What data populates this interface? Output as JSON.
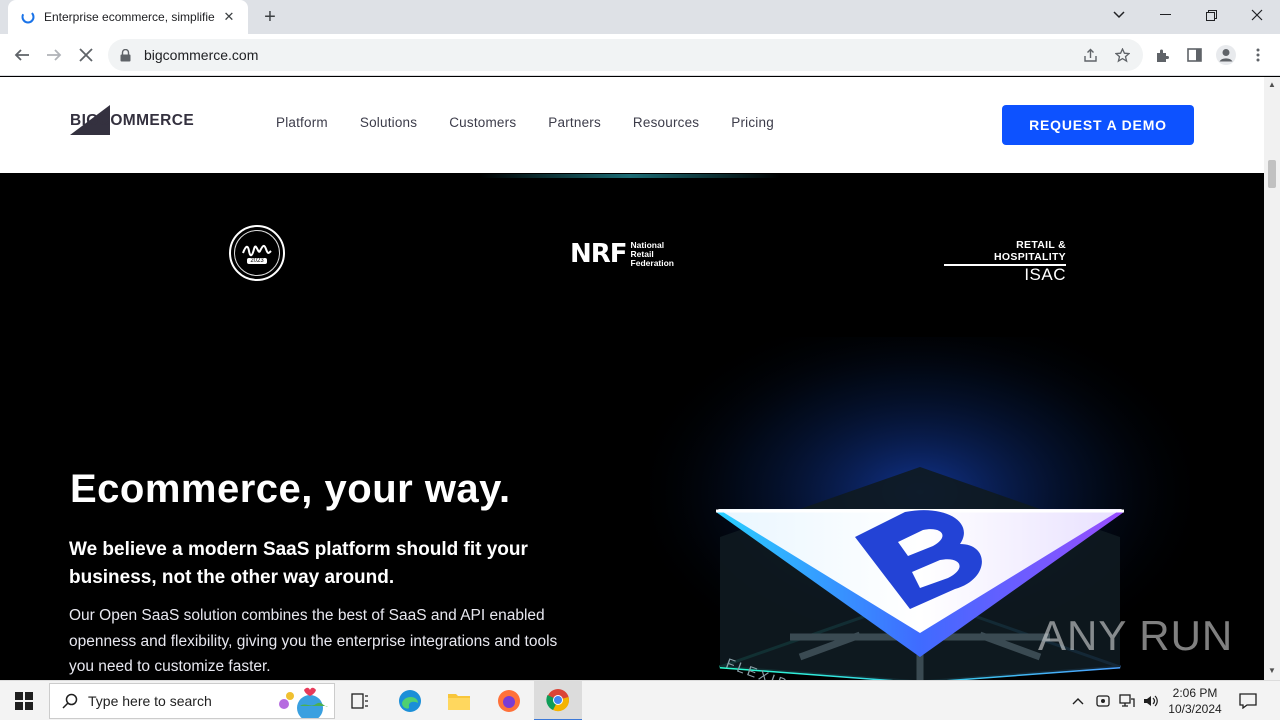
{
  "browser": {
    "tab_title": "Enterprise ecommerce, simplifie",
    "url": "bigcommerce.com"
  },
  "site": {
    "logo_text": "BIGCOMMERCE",
    "nav": [
      "Platform",
      "Solutions",
      "Customers",
      "Partners",
      "Resources",
      "Pricing"
    ],
    "cta": "REQUEST A DEMO"
  },
  "badges": {
    "seal_text": "2023",
    "nrf_big": "NRF",
    "nrf_line1": "National",
    "nrf_line2": "Retail",
    "nrf_line3": "Federation",
    "isac_line1": "RETAIL & HOSPITALITY",
    "isac_line2": "ISAC"
  },
  "hero": {
    "title": "Ecommerce, your way.",
    "subtitle": "We believe a modern SaaS platform should fit your business, not the other way around.",
    "body": "Our Open SaaS solution combines the best of SaaS and API enabled openness and flexibility, giving you the enterprise integrations and tools you need to customize faster.",
    "art_label": "FLEXIBILITY"
  },
  "watermark": "ANY RUN",
  "taskbar": {
    "search_placeholder": "Type here to search",
    "time": "2:06 PM",
    "date": "10/3/2024"
  }
}
